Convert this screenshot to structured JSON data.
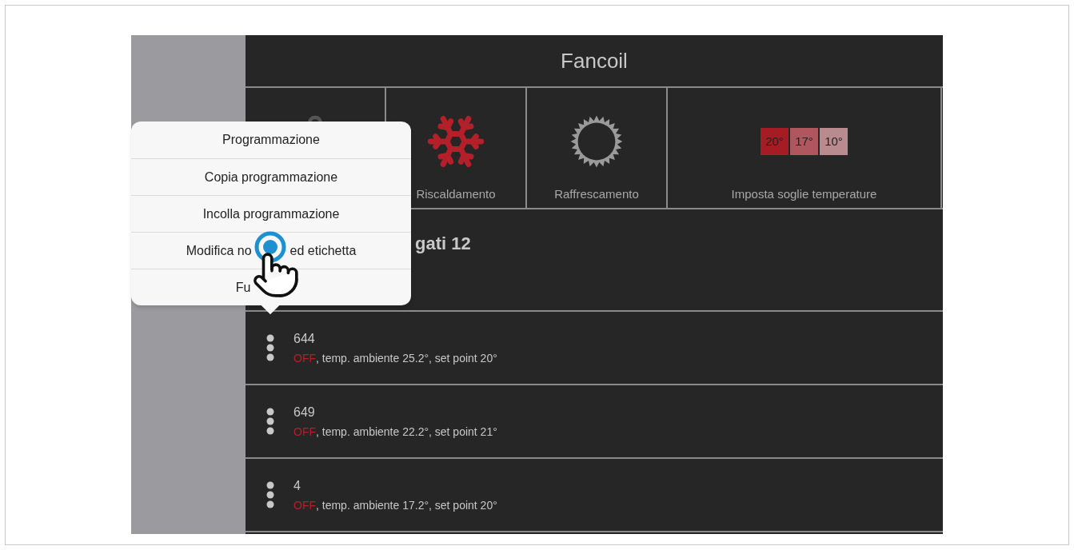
{
  "title": "Fancoil",
  "tiles": [
    {
      "kind": "gear"
    },
    {
      "kind": "snowflake",
      "label": "Riscaldamento"
    },
    {
      "kind": "sun",
      "label": "Raffrescamento"
    },
    {
      "kind": "thresholds",
      "label": "Imposta soglie temperature",
      "thresholds": [
        {
          "text": "20°",
          "color": "#a51c24"
        },
        {
          "text": "17°",
          "color": "#b0565f"
        },
        {
          "text": "10°",
          "color": "#b98b8f"
        }
      ]
    }
  ],
  "heading": "gati 12",
  "devices": [
    {
      "name": "644",
      "status": "OFF",
      "on": false,
      "details": ", temp. ambiente 25.2°, set point 20°"
    },
    {
      "name": "649",
      "status": "OFF",
      "on": false,
      "details": ", temp. ambiente 22.2°, set point 21°"
    },
    {
      "name": "4",
      "status": "OFF",
      "on": false,
      "details": ", temp. ambiente 17.2°, set point 20°"
    }
  ],
  "menu": {
    "items": [
      {
        "kind": "full",
        "parts": [
          "Programmazione"
        ]
      },
      {
        "kind": "full",
        "parts": [
          "Copia programmazione"
        ]
      },
      {
        "kind": "full",
        "parts": [
          "Incolla programmazione"
        ]
      },
      {
        "kind": "split",
        "parts": [
          "Modifica no",
          "ed etichetta"
        ]
      },
      {
        "kind": "cut",
        "parts": [
          "Fu"
        ]
      }
    ]
  }
}
